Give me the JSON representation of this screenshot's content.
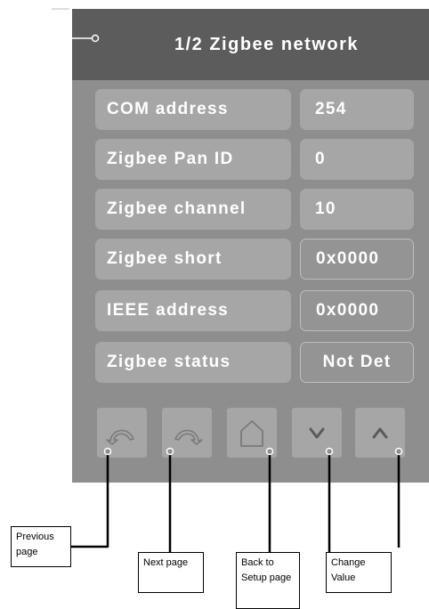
{
  "header": {
    "title": "1/2 Zigbee network"
  },
  "rows": [
    {
      "label": "COM address",
      "value": "254"
    },
    {
      "label": "Zigbee Pan ID",
      "value": "0"
    },
    {
      "label": "Zigbee channel",
      "value": "10"
    },
    {
      "label": "Zigbee short",
      "value": "0x0000"
    },
    {
      "label": "IEEE address",
      "value": "0x0000"
    },
    {
      "label": "Zigbee status",
      "value": "Not Det"
    }
  ],
  "buttons": [
    {
      "name": "previous-page",
      "icon": "undo-arrow-icon"
    },
    {
      "name": "next-page",
      "icon": "redo-arrow-icon"
    },
    {
      "name": "back-to-setup",
      "icon": "home-icon"
    },
    {
      "name": "value-down",
      "icon": "chevron-down-icon"
    },
    {
      "name": "value-up",
      "icon": "chevron-up-icon"
    }
  ],
  "callouts": {
    "previous_page": "Previous page",
    "next_page": "Next page",
    "back_to_setup": "Back to Setup page",
    "change_value": "Change Value"
  },
  "colors": {
    "panel": "#8e8e8e",
    "header": "#5c5c5c",
    "field": "#a6a6a6",
    "text": "#ffffff"
  }
}
